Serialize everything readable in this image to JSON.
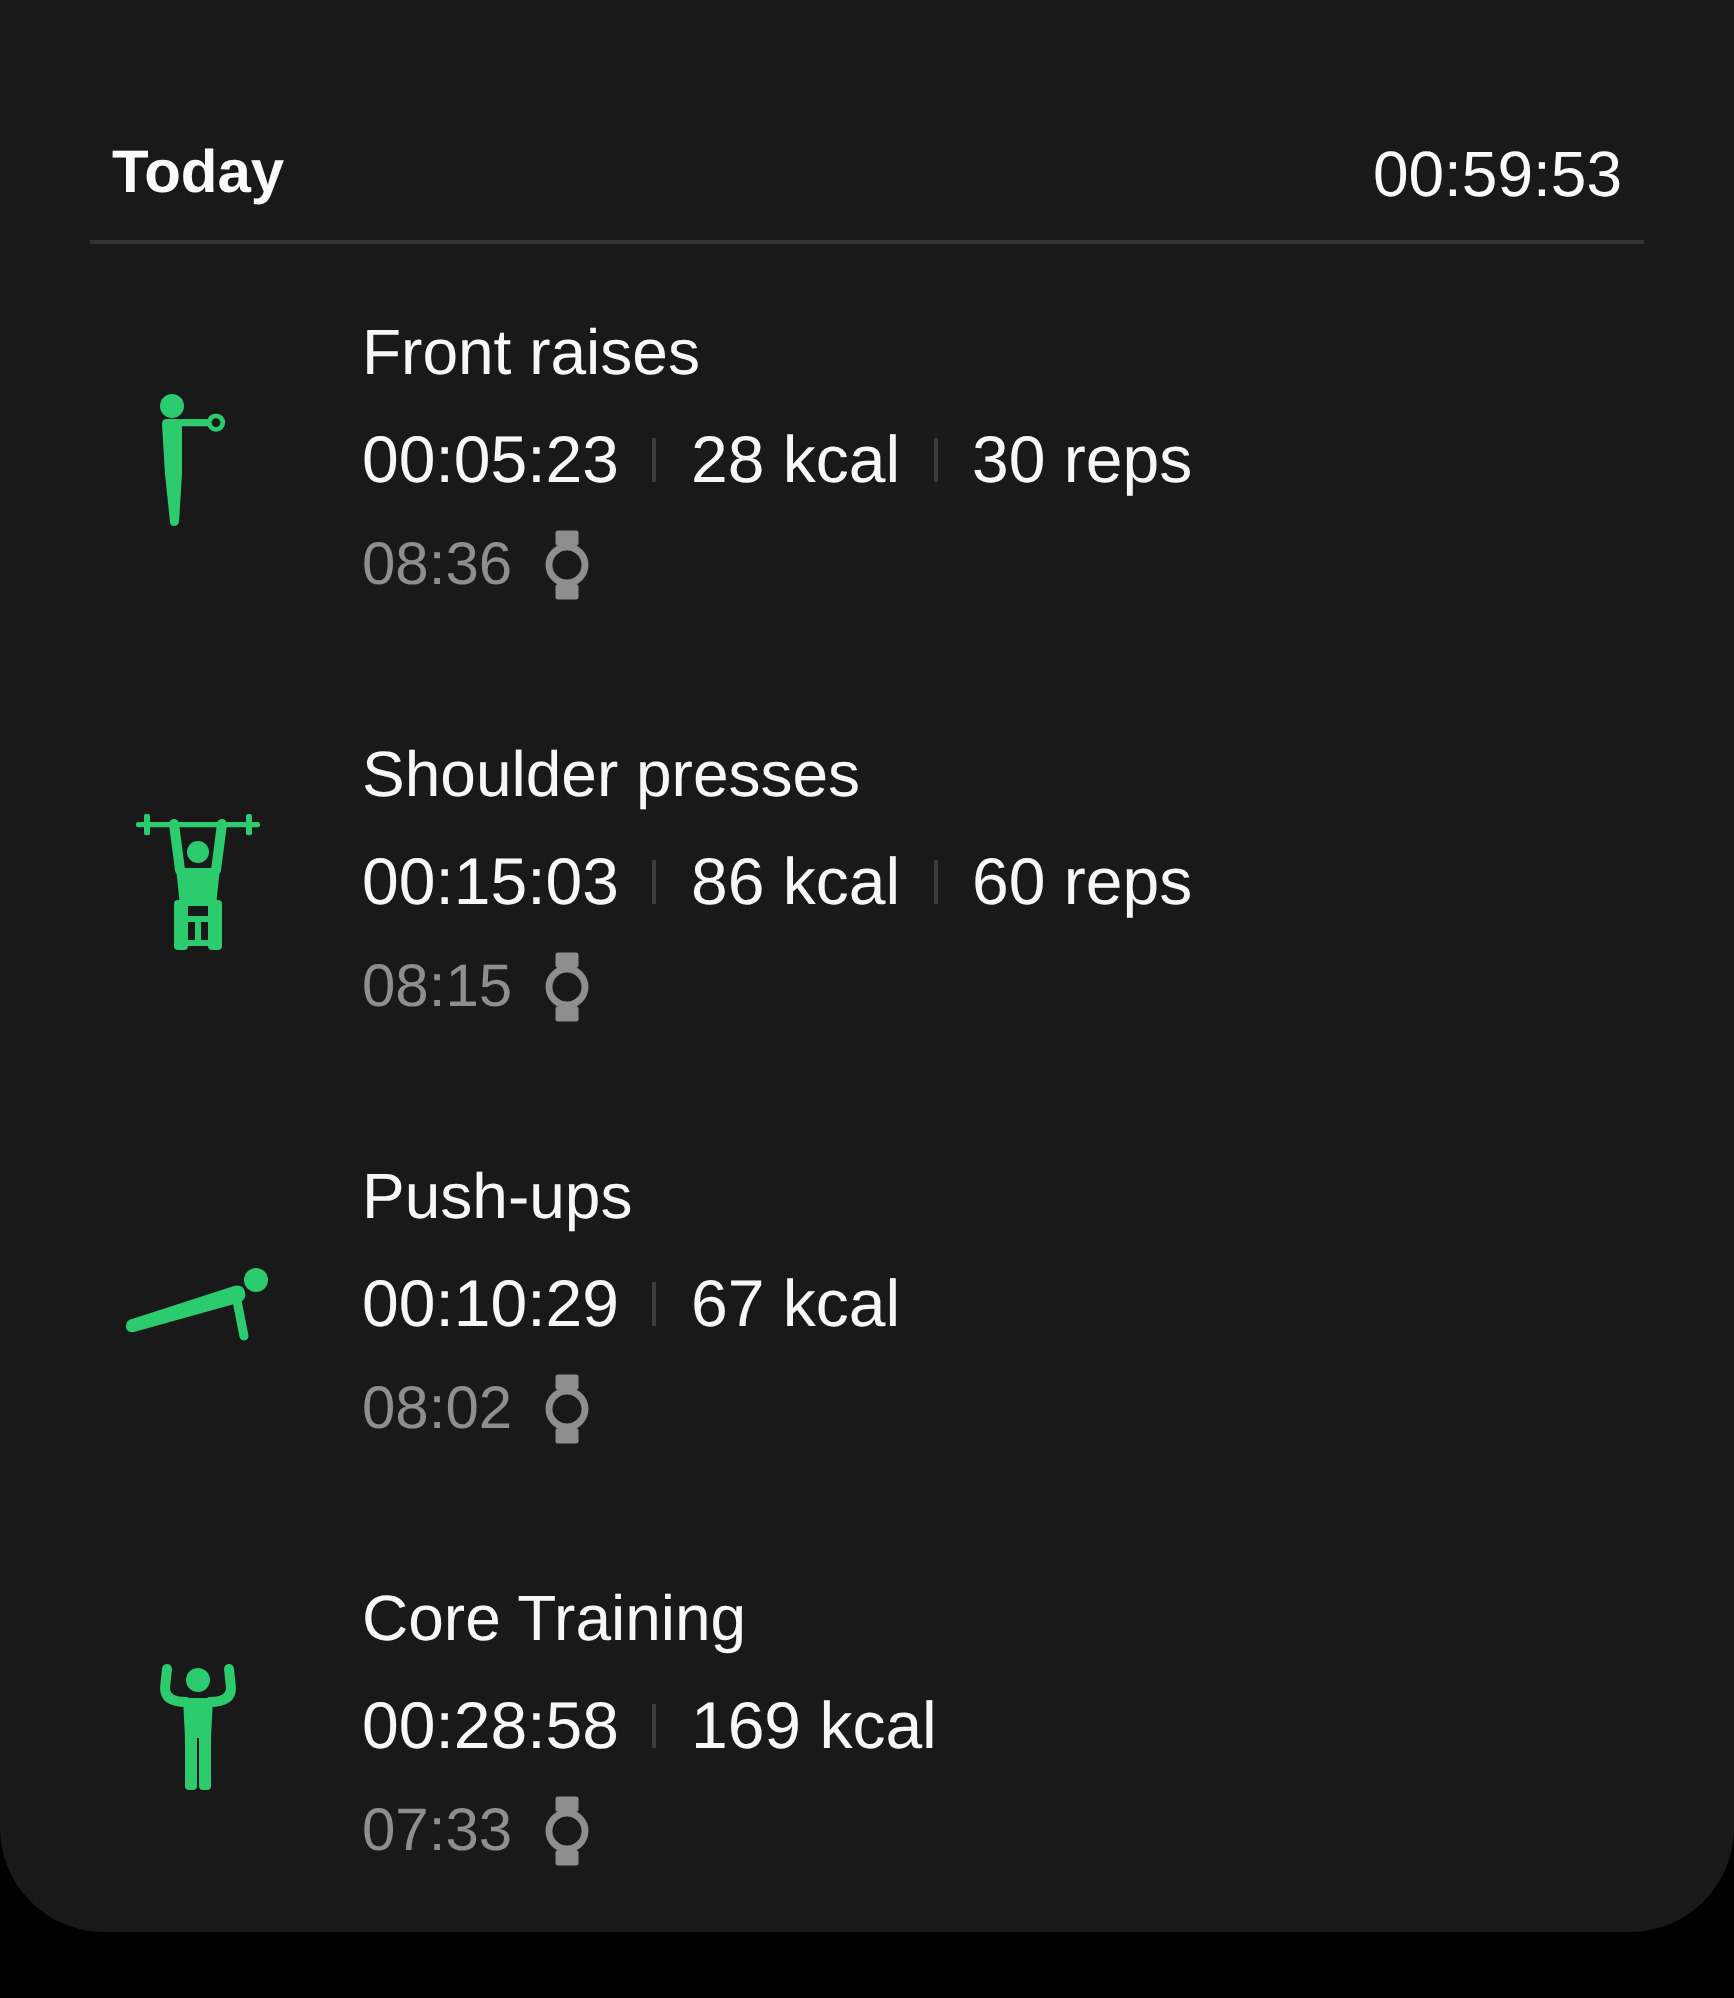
{
  "header": {
    "title": "Today",
    "total_duration": "00:59:53"
  },
  "workouts": [
    {
      "kind": "front_raise",
      "name": "Front raises",
      "stats": [
        "00:05:23",
        "28 kcal",
        "30 reps"
      ],
      "start_time": "08:36"
    },
    {
      "kind": "shoulder_press",
      "name": "Shoulder presses",
      "stats": [
        "00:15:03",
        "86 kcal",
        "60 reps"
      ],
      "start_time": "08:15"
    },
    {
      "kind": "push_up",
      "name": "Push-ups",
      "stats": [
        "00:10:29",
        "67 kcal"
      ],
      "start_time": "08:02"
    },
    {
      "kind": "core",
      "name": "Core Training",
      "stats": [
        "00:28:58",
        "169 kcal"
      ],
      "start_time": "07:33"
    }
  ]
}
